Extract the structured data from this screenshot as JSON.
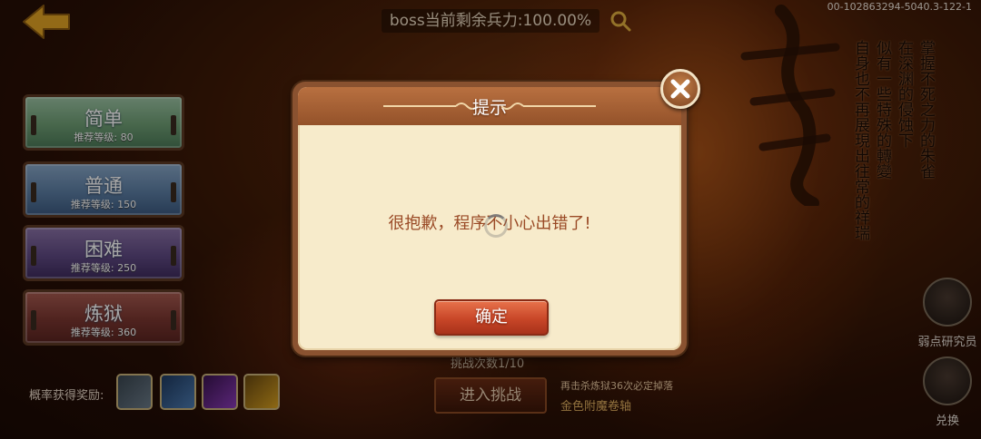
{
  "hud": {
    "boss_hp": "boss当前剩余兵力:100.00%",
    "build_id": "00-102863294-5040.3-122-1"
  },
  "difficulty": [
    {
      "name": "简单",
      "level": "推荐等级: 80"
    },
    {
      "name": "普通",
      "level": "推荐等级: 150"
    },
    {
      "name": "困难",
      "level": "推荐等级: 250"
    },
    {
      "name": "炼狱",
      "level": "推荐等级: 360"
    }
  ],
  "rewards": {
    "label": "概率获得奖励:",
    "items": [
      "reward-gray",
      "reward-blue",
      "reward-purple",
      "reward-gold"
    ]
  },
  "challenge": {
    "count": "挑战次数1/10",
    "enter_label": "进入挑战",
    "drop_note": "再击杀炼狱36次必定掉落",
    "drop_item": "金色附魔卷轴"
  },
  "boss_info": {
    "vertical_lines": [
      "掌握不死之力的朱雀",
      "在深渊的侵蚀下",
      "似有一些特殊的轉變",
      "自身也不再展現出往常的祥瑞"
    ]
  },
  "side_buttons": {
    "research": "弱点研究员",
    "exchange": "兑换"
  },
  "dialog": {
    "title": "提示",
    "message": "很抱歉，程序不小心出错了!",
    "confirm_label": "确定"
  },
  "icons": {
    "back": "back-arrow-icon",
    "search": "magnifier-icon",
    "close": "close-icon",
    "loading": "spinner-icon"
  },
  "colors": {
    "dialog_bg": "#f7ebcb",
    "dialog_header": "#a35e34",
    "confirm": "#c84628",
    "message_text": "#9a4a26"
  }
}
